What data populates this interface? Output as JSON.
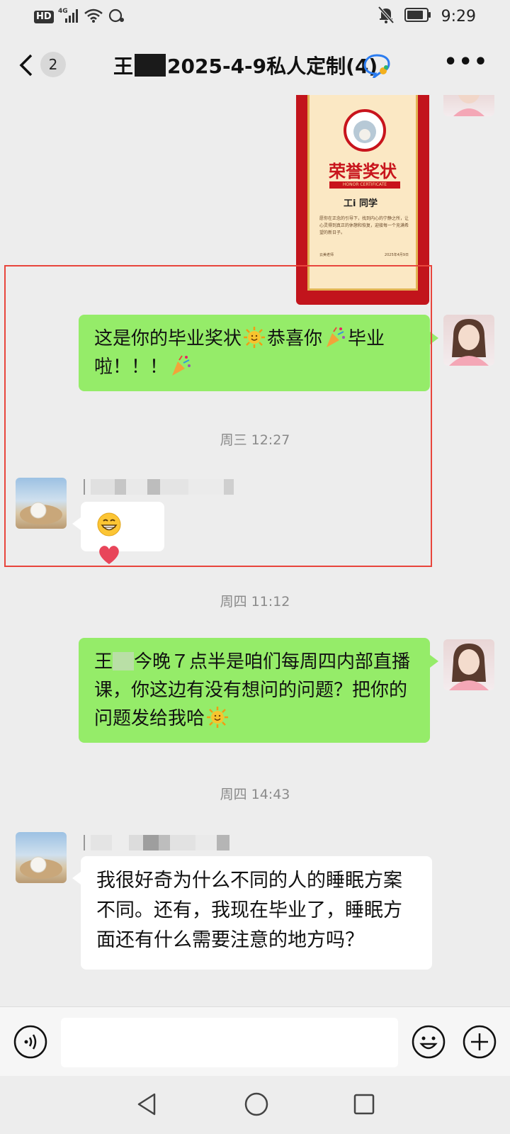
{
  "status_bar": {
    "hd": "HD",
    "network": "4G",
    "time": "9:29"
  },
  "nav": {
    "unread_count": "2",
    "title_prefix": "王",
    "title_suffix": "2025-4-9私人定制(4)"
  },
  "certificate": {
    "title": "荣誉奖状",
    "subtitle": "HONOR CERTIFICATE",
    "recipient": "工i 同学",
    "body": "愿你在正念的引导下，找到内心的宁静之所，让心灵得到真正的休憩和恢复，迎接每一个充满希望的新日子。",
    "signer": "云美老师",
    "date": "2025年4月9日"
  },
  "messages": [
    {
      "side": "right",
      "text": "这是你的毕业奖状",
      "text2": "恭喜你",
      "text3": "毕业啦！！！"
    },
    {
      "timestamp": "周三 12:27"
    },
    {
      "side": "left",
      "emojis": [
        "grin",
        "heart"
      ]
    },
    {
      "timestamp": "周四 11:12"
    },
    {
      "side": "right",
      "text": "王",
      "text2": "今晚７点半是咱们每周四内部直播课，你这边有没有想问的问题？把你的问题发给我哈"
    },
    {
      "timestamp": "周四 14:43"
    },
    {
      "side": "left",
      "text": "我很好奇为什么不同的人的睡眠方案不同。还有，我现在毕业了，睡眠方面还有什么需要注意的地方吗？"
    }
  ],
  "input": {
    "placeholder": ""
  },
  "icons": {
    "back": "chevron-left-icon",
    "more": "more-icon",
    "voice": "voice-icon",
    "emoji": "emoji-icon",
    "plus": "plus-icon"
  },
  "colors": {
    "background": "#ededed",
    "green_bubble": "#95ec69",
    "white_bubble": "#ffffff",
    "highlight_border": "#e8453c",
    "timestamp_text": "#8a8a8a"
  }
}
